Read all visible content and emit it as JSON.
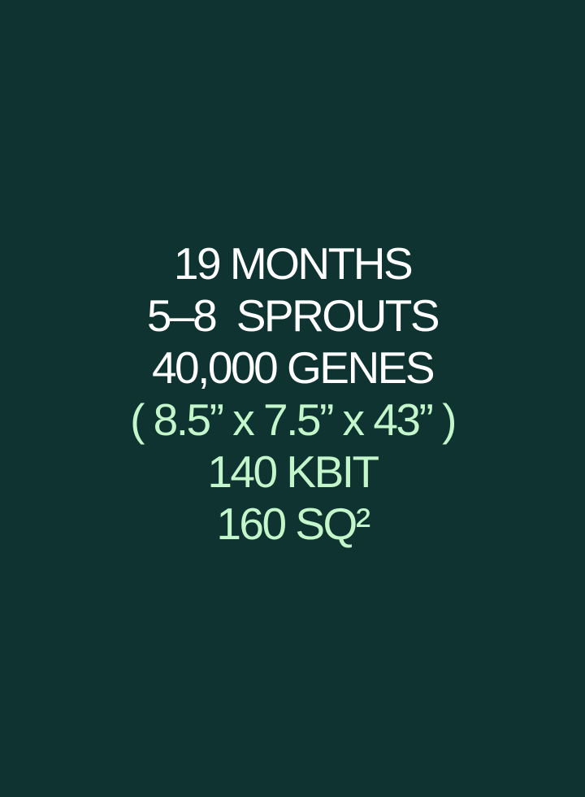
{
  "colors": {
    "background": "#0f3330",
    "primary_text": "#ffffff",
    "accent_text": "#c4f6cc"
  },
  "lines": [
    {
      "text": "19 MONTHS",
      "color": "primary_text"
    },
    {
      "text": "5–8  SPROUTS",
      "color": "primary_text"
    },
    {
      "text": "40,000 GENES",
      "color": "primary_text"
    },
    {
      "text": "( 8.5” x 7.5” x 43” )",
      "color": "accent_text"
    },
    {
      "text": "140 KBIT",
      "color": "accent_text"
    },
    {
      "text": "160 SQ²",
      "color": "accent_text"
    }
  ]
}
